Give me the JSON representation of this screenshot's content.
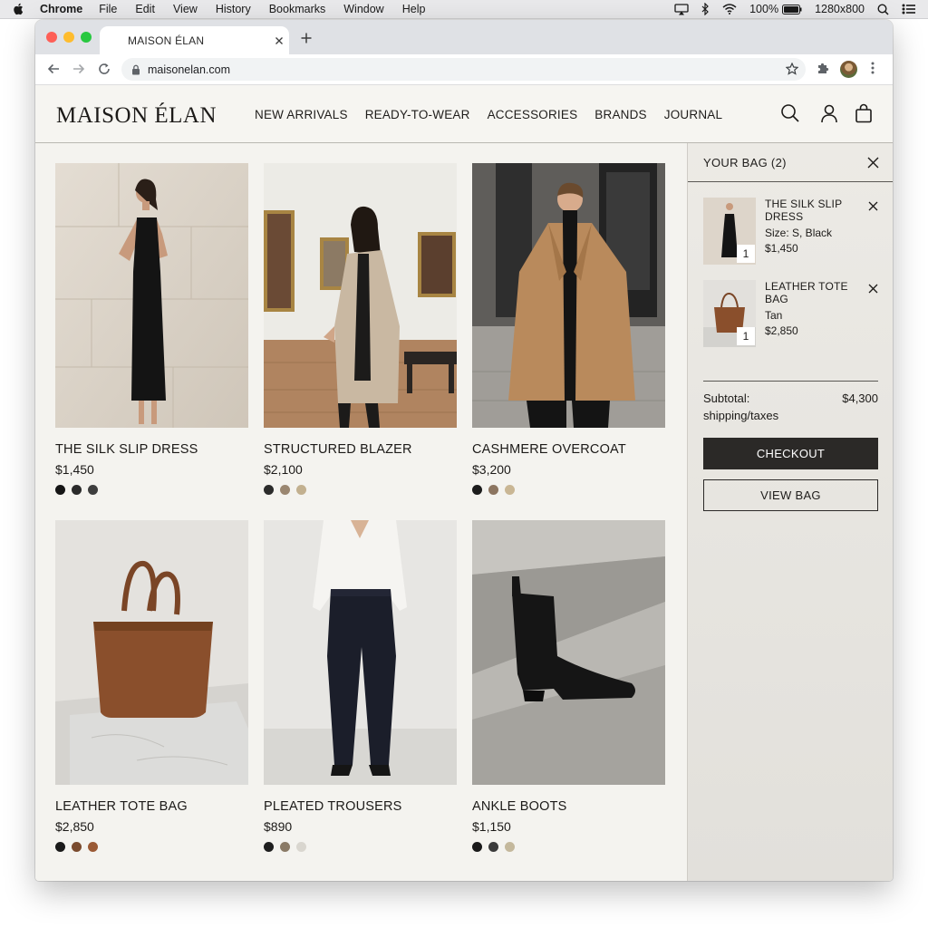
{
  "os_menubar": {
    "app_name": "Chrome",
    "menus": [
      "File",
      "Edit",
      "View",
      "History",
      "Bookmarks",
      "Window",
      "Help"
    ],
    "battery": "100%",
    "resolution": "1280x800"
  },
  "browser": {
    "tab_title": "MAISON ÉLAN",
    "url": "maisonelan.com"
  },
  "site": {
    "logo": "MAISON ÉLAN",
    "nav": [
      "NEW ARRIVALS",
      "READY-TO-WEAR",
      "ACCESSORIES",
      "BRANDS",
      "JOURNAL"
    ]
  },
  "products": [
    {
      "name": "THE SILK SLIP DRESS",
      "price": "$1,450",
      "swatches": [
        "#151515",
        "#2a2a2a",
        "#3d3d3d"
      ]
    },
    {
      "name": "STRUCTURED BLAZER",
      "price": "$2,100",
      "swatches": [
        "#2b2b2b",
        "#9a8670",
        "#c2b08f"
      ]
    },
    {
      "name": "CASHMERE OVERCOAT",
      "price": "$3,200",
      "swatches": [
        "#1c1c1c",
        "#8c7560",
        "#c9b694"
      ]
    },
    {
      "name": "LEATHER TOTE BAG",
      "price": "$2,850",
      "swatches": [
        "#1a1a1a",
        "#7a4b2e",
        "#9a5a35"
      ]
    },
    {
      "name": "PLEATED TROUSERS",
      "price": "$890",
      "swatches": [
        "#1e1e1e",
        "#8a7a66",
        "#d9d6cf"
      ]
    },
    {
      "name": "ANKLE BOOTS",
      "price": "$1,150",
      "swatches": [
        "#1a1a1a",
        "#3b3b3b",
        "#c4b89c"
      ]
    }
  ],
  "bag": {
    "title": "YOUR BAG (2)",
    "items": [
      {
        "name": "THE SILK SLIP DRESS",
        "meta": "Size: S, Black",
        "price": "$1,450",
        "qty": "1"
      },
      {
        "name": "LEATHER TOTE BAG",
        "meta": "Tan",
        "price": "$2,850",
        "qty": "1"
      }
    ],
    "subtotal_label": "Subtotal:",
    "subtotal_amount": "$4,300",
    "subtotal_note": "shipping/taxes",
    "checkout_label": "CHECKOUT",
    "view_bag_label": "VIEW BAG"
  }
}
